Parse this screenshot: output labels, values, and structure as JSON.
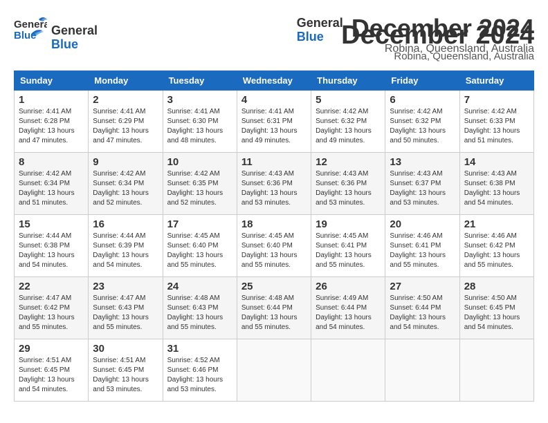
{
  "header": {
    "logo_general": "General",
    "logo_blue": "Blue",
    "title": "December 2024",
    "subtitle": "Robina, Queensland, Australia"
  },
  "columns": [
    "Sunday",
    "Monday",
    "Tuesday",
    "Wednesday",
    "Thursday",
    "Friday",
    "Saturday"
  ],
  "weeks": [
    [
      {
        "day": "1",
        "info": "Sunrise: 4:41 AM\nSunset: 6:28 PM\nDaylight: 13 hours and 47 minutes."
      },
      {
        "day": "2",
        "info": "Sunrise: 4:41 AM\nSunset: 6:29 PM\nDaylight: 13 hours and 47 minutes."
      },
      {
        "day": "3",
        "info": "Sunrise: 4:41 AM\nSunset: 6:30 PM\nDaylight: 13 hours and 48 minutes."
      },
      {
        "day": "4",
        "info": "Sunrise: 4:41 AM\nSunset: 6:31 PM\nDaylight: 13 hours and 49 minutes."
      },
      {
        "day": "5",
        "info": "Sunrise: 4:42 AM\nSunset: 6:32 PM\nDaylight: 13 hours and 49 minutes."
      },
      {
        "day": "6",
        "info": "Sunrise: 4:42 AM\nSunset: 6:32 PM\nDaylight: 13 hours and 50 minutes."
      },
      {
        "day": "7",
        "info": "Sunrise: 4:42 AM\nSunset: 6:33 PM\nDaylight: 13 hours and 51 minutes."
      }
    ],
    [
      {
        "day": "8",
        "info": "Sunrise: 4:42 AM\nSunset: 6:34 PM\nDaylight: 13 hours and 51 minutes."
      },
      {
        "day": "9",
        "info": "Sunrise: 4:42 AM\nSunset: 6:34 PM\nDaylight: 13 hours and 52 minutes."
      },
      {
        "day": "10",
        "info": "Sunrise: 4:42 AM\nSunset: 6:35 PM\nDaylight: 13 hours and 52 minutes."
      },
      {
        "day": "11",
        "info": "Sunrise: 4:43 AM\nSunset: 6:36 PM\nDaylight: 13 hours and 53 minutes."
      },
      {
        "day": "12",
        "info": "Sunrise: 4:43 AM\nSunset: 6:36 PM\nDaylight: 13 hours and 53 minutes."
      },
      {
        "day": "13",
        "info": "Sunrise: 4:43 AM\nSunset: 6:37 PM\nDaylight: 13 hours and 53 minutes."
      },
      {
        "day": "14",
        "info": "Sunrise: 4:43 AM\nSunset: 6:38 PM\nDaylight: 13 hours and 54 minutes."
      }
    ],
    [
      {
        "day": "15",
        "info": "Sunrise: 4:44 AM\nSunset: 6:38 PM\nDaylight: 13 hours and 54 minutes."
      },
      {
        "day": "16",
        "info": "Sunrise: 4:44 AM\nSunset: 6:39 PM\nDaylight: 13 hours and 54 minutes."
      },
      {
        "day": "17",
        "info": "Sunrise: 4:45 AM\nSunset: 6:40 PM\nDaylight: 13 hours and 55 minutes."
      },
      {
        "day": "18",
        "info": "Sunrise: 4:45 AM\nSunset: 6:40 PM\nDaylight: 13 hours and 55 minutes."
      },
      {
        "day": "19",
        "info": "Sunrise: 4:45 AM\nSunset: 6:41 PM\nDaylight: 13 hours and 55 minutes."
      },
      {
        "day": "20",
        "info": "Sunrise: 4:46 AM\nSunset: 6:41 PM\nDaylight: 13 hours and 55 minutes."
      },
      {
        "day": "21",
        "info": "Sunrise: 4:46 AM\nSunset: 6:42 PM\nDaylight: 13 hours and 55 minutes."
      }
    ],
    [
      {
        "day": "22",
        "info": "Sunrise: 4:47 AM\nSunset: 6:42 PM\nDaylight: 13 hours and 55 minutes."
      },
      {
        "day": "23",
        "info": "Sunrise: 4:47 AM\nSunset: 6:43 PM\nDaylight: 13 hours and 55 minutes."
      },
      {
        "day": "24",
        "info": "Sunrise: 4:48 AM\nSunset: 6:43 PM\nDaylight: 13 hours and 55 minutes."
      },
      {
        "day": "25",
        "info": "Sunrise: 4:48 AM\nSunset: 6:44 PM\nDaylight: 13 hours and 55 minutes."
      },
      {
        "day": "26",
        "info": "Sunrise: 4:49 AM\nSunset: 6:44 PM\nDaylight: 13 hours and 54 minutes."
      },
      {
        "day": "27",
        "info": "Sunrise: 4:50 AM\nSunset: 6:44 PM\nDaylight: 13 hours and 54 minutes."
      },
      {
        "day": "28",
        "info": "Sunrise: 4:50 AM\nSunset: 6:45 PM\nDaylight: 13 hours and 54 minutes."
      }
    ],
    [
      {
        "day": "29",
        "info": "Sunrise: 4:51 AM\nSunset: 6:45 PM\nDaylight: 13 hours and 54 minutes."
      },
      {
        "day": "30",
        "info": "Sunrise: 4:51 AM\nSunset: 6:45 PM\nDaylight: 13 hours and 53 minutes."
      },
      {
        "day": "31",
        "info": "Sunrise: 4:52 AM\nSunset: 6:46 PM\nDaylight: 13 hours and 53 minutes."
      },
      {
        "day": "",
        "info": ""
      },
      {
        "day": "",
        "info": ""
      },
      {
        "day": "",
        "info": ""
      },
      {
        "day": "",
        "info": ""
      }
    ]
  ]
}
